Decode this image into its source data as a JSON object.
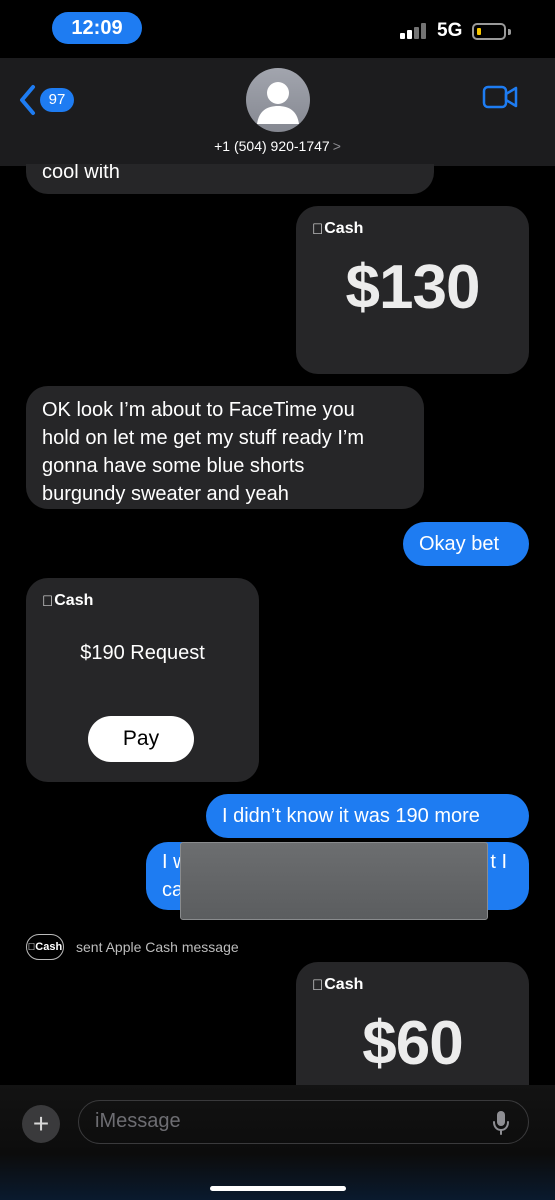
{
  "status_bar": {
    "time": "12:09",
    "network": "5G",
    "battery_color": "#f7c600"
  },
  "header": {
    "unread_count": "97",
    "contact_name": "+1 (504) 920-1747",
    "chevron": ">",
    "icons": {
      "back": "chevron-left-icon",
      "video": "video-camera-icon",
      "avatar": "person-silhouette-icon"
    }
  },
  "messages": [
    {
      "type": "incoming",
      "text": "cool with"
    },
    {
      "type": "apple_cash_outgoing",
      "brand": "Cash",
      "amount": "$130"
    },
    {
      "type": "incoming",
      "text": "OK look I’m about to FaceTime you\nhold on let me get my stuff ready I’m\ngonna have some blue shorts\nburgundy sweater and yeah"
    },
    {
      "type": "outgoing",
      "text": "Okay bet"
    },
    {
      "type": "apple_cash_request",
      "brand": "Cash",
      "label": "$190 Request",
      "button": "Pay"
    },
    {
      "type": "outgoing",
      "text": "I didn’t know it was 190 more"
    },
    {
      "type": "outgoing_redacted",
      "text_start": "I w",
      "text_start_line2": "ca",
      "text_end": "t I"
    },
    {
      "type": "system",
      "badge": "Cash",
      "text": "sent Apple Cash message"
    },
    {
      "type": "apple_cash_outgoing",
      "brand": "Cash",
      "amount": "$60"
    }
  ],
  "composer": {
    "placeholder": "iMessage",
    "plus": "+",
    "icons": {
      "add": "plus-icon",
      "mic": "microphone-icon"
    }
  },
  "colors": {
    "blue": "#1e7cf2",
    "incoming_bubble": "#262628",
    "header_bg": "#1c1c1e"
  }
}
